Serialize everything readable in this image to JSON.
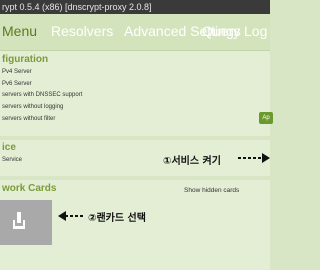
{
  "window": {
    "title": "rypt 0.5.4 (x86) [dnscrypt-proxy 2.0.8]"
  },
  "tabs": [
    {
      "label": "Menu",
      "active": true
    },
    {
      "label": "Resolvers",
      "active": false
    },
    {
      "label": "Advanced Settings",
      "active": false
    },
    {
      "label": "Query Log",
      "active": false
    }
  ],
  "config": {
    "title": "figuration",
    "rows": [
      "Pv4 Server",
      "Pv6 Server",
      "servers with DNSSEC support",
      "servers without logging",
      "servers without filter"
    ],
    "apply_label": "Ap"
  },
  "service": {
    "title": "ice",
    "row": "Service",
    "annotation": "①서비스 켜기"
  },
  "network": {
    "title": "work Cards",
    "show_hidden": "Show hidden cards",
    "annotation": "②랜카드 선택"
  },
  "colors": {
    "accent": "#7b9a3b",
    "tab_active": "#5b7a1e",
    "card_bg": "#a9a9a9",
    "button": "#6b9a2c"
  }
}
